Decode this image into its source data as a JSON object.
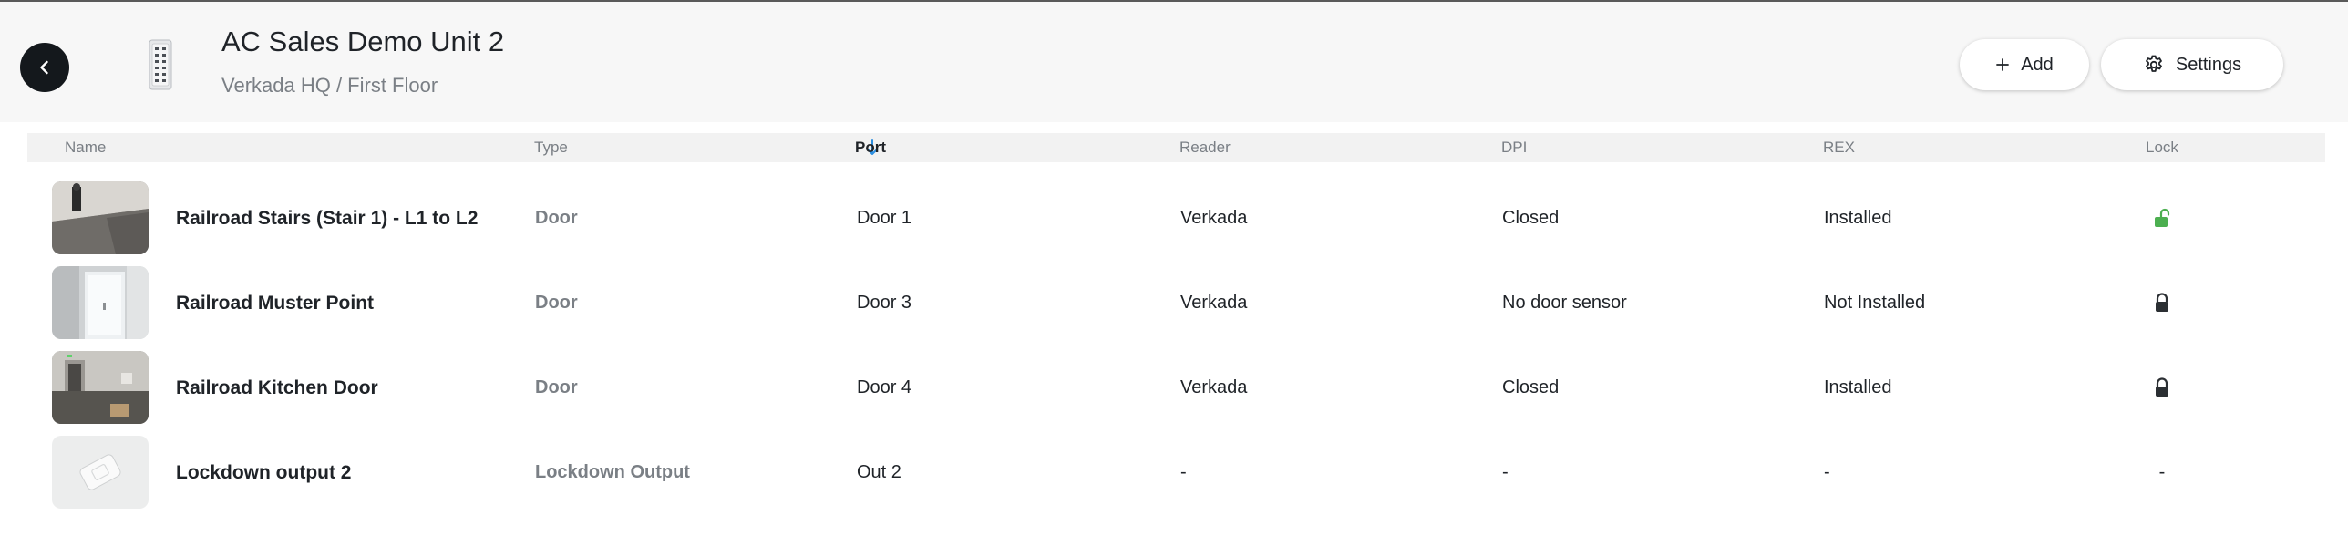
{
  "header": {
    "title": "AC Sales Demo Unit 2",
    "breadcrumb": "Verkada HQ / First Floor",
    "add_label": "Add",
    "settings_label": "Settings"
  },
  "table": {
    "columns": {
      "name": "Name",
      "type": "Type",
      "port": "Port",
      "reader": "Reader",
      "dpi": "DPI",
      "rex": "REX",
      "lock": "Lock"
    },
    "sort": {
      "column": "Port",
      "direction": "descending"
    },
    "rows": [
      {
        "name": "Railroad Stairs (Stair 1) - L1 to L2",
        "type": "Door",
        "port": "Door 1",
        "reader": "Verkada",
        "dpi": "Closed",
        "rex": "Installed",
        "lock": "unlocked-icon"
      },
      {
        "name": "Railroad Muster Point",
        "type": "Door",
        "port": "Door 3",
        "reader": "Verkada",
        "dpi": "No door sensor",
        "rex": "Not Installed",
        "lock": "locked-icon"
      },
      {
        "name": "Railroad Kitchen Door",
        "type": "Door",
        "port": "Door 4",
        "reader": "Verkada",
        "dpi": "Closed",
        "rex": "Installed",
        "lock": "locked-icon"
      },
      {
        "name": "Lockdown output 2",
        "type": "Lockdown Output",
        "port": "Out 2",
        "reader": "-",
        "dpi": "-",
        "rex": "-",
        "lock": "-"
      }
    ]
  },
  "colors": {
    "unlocked": "#4caf50",
    "locked": "#2b2f33",
    "sort_arrow": "#2d8fe0"
  }
}
